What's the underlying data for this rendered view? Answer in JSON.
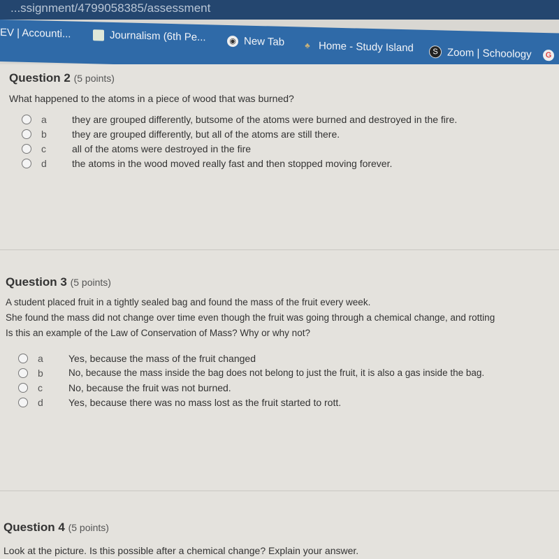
{
  "browser": {
    "url": "...ssignment/4799058385/assessment",
    "bookmarks": [
      {
        "label": "EV | Accounti...",
        "icon": "none"
      },
      {
        "label": "Journalism (6th Pe...",
        "icon": "image-icon"
      },
      {
        "label": "New Tab",
        "icon": "globe-icon"
      },
      {
        "label": "Home - Study Island",
        "icon": "palm-tree-icon"
      },
      {
        "label": "Zoom | Schoology",
        "icon": "schoology-icon"
      },
      {
        "label": "G",
        "icon": "google-icon"
      }
    ]
  },
  "questions": [
    {
      "title": "Question 2",
      "points": "(5 points)",
      "text": [
        "What happened to the atoms in a piece of wood that was burned?"
      ],
      "options": [
        {
          "letter": "a",
          "text": "they are grouped differently, butsome of the atoms were burned and destroyed in the fire."
        },
        {
          "letter": "b",
          "text": "they are grouped differently, but all of the atoms are still there."
        },
        {
          "letter": "c",
          "text": "all of the atoms were destroyed in the fire"
        },
        {
          "letter": "d",
          "text": "the atoms in the wood moved really fast and then stopped moving forever."
        }
      ]
    },
    {
      "title": "Question 3",
      "points": "(5 points)",
      "text": [
        "A student placed fruit in a tightly sealed bag and found the mass of the fruit every week.",
        "She found the mass did not change over time even though the fruit was going through a chemical change, and rotting",
        "Is this an example of the Law of Conservation of Mass?  Why or why not?"
      ],
      "options": [
        {
          "letter": "a",
          "text": "Yes, because the mass of the fruit changed"
        },
        {
          "letter": "b",
          "text": "No, because the mass inside the bag does not belong to just the fruit, it is also a gas inside the bag."
        },
        {
          "letter": "c",
          "text": "No, because the fruit was not burned."
        },
        {
          "letter": "d",
          "text": "Yes, because there was no mass lost as the fruit started to rott."
        }
      ]
    },
    {
      "title": "Question 4",
      "points": "(5 points)",
      "text": [
        "Look at the picture.  Is this possible after a chemical change?  Explain your answer."
      ],
      "options": []
    }
  ]
}
